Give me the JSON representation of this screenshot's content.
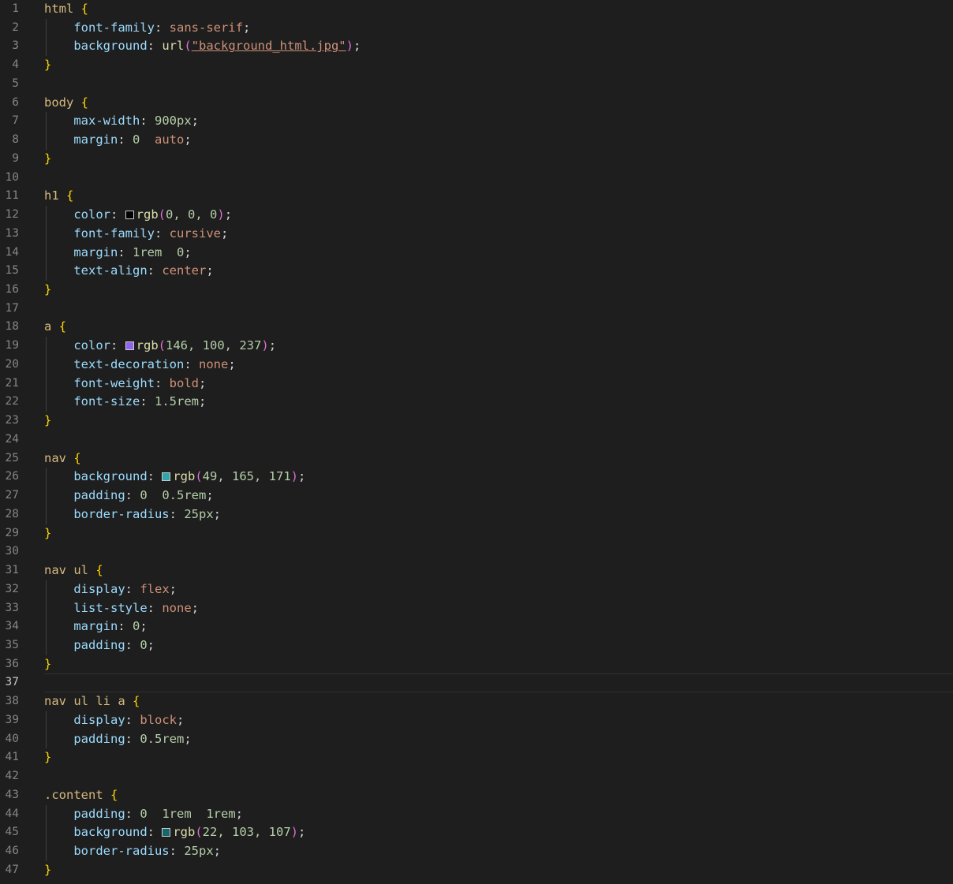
{
  "line_numbers": [
    "1",
    "2",
    "3",
    "4",
    "5",
    "6",
    "7",
    "8",
    "9",
    "10",
    "11",
    "12",
    "13",
    "14",
    "15",
    "16",
    "17",
    "18",
    "19",
    "20",
    "21",
    "22",
    "23",
    "24",
    "25",
    "26",
    "27",
    "28",
    "29",
    "30",
    "31",
    "32",
    "33",
    "34",
    "35",
    "36",
    "37",
    "38",
    "39",
    "40",
    "41",
    "42",
    "43",
    "44",
    "45",
    "46",
    "47"
  ],
  "active_line": "37",
  "code": {
    "l1": {
      "sel": "html",
      "brace": "{"
    },
    "l2": {
      "prop": "font-family",
      "val": "sans-serif"
    },
    "l3": {
      "prop": "background",
      "fn": "url",
      "str": "\"background_html.jpg\""
    },
    "l4": {
      "brace": "}"
    },
    "l6": {
      "sel": "body",
      "brace": "{"
    },
    "l7": {
      "prop": "max-width",
      "num": "900px"
    },
    "l8": {
      "prop": "margin",
      "num": "0",
      "val": "auto"
    },
    "l9": {
      "brace": "}"
    },
    "l11": {
      "sel": "h1",
      "brace": "{"
    },
    "l12": {
      "prop": "color",
      "fn": "rgb",
      "args": "0, 0, 0",
      "swatch": "#000000"
    },
    "l13": {
      "prop": "font-family",
      "val": "cursive"
    },
    "l14": {
      "prop": "margin",
      "num1": "1rem",
      "num2": "0"
    },
    "l15": {
      "prop": "text-align",
      "val": "center"
    },
    "l16": {
      "brace": "}"
    },
    "l18": {
      "sel": "a",
      "brace": "{"
    },
    "l19": {
      "prop": "color",
      "fn": "rgb",
      "args": "146, 100, 237",
      "swatch": "#9264ed"
    },
    "l20": {
      "prop": "text-decoration",
      "val": "none"
    },
    "l21": {
      "prop": "font-weight",
      "val": "bold"
    },
    "l22": {
      "prop": "font-size",
      "num": "1.5rem"
    },
    "l23": {
      "brace": "}"
    },
    "l25": {
      "sel": "nav",
      "brace": "{"
    },
    "l26": {
      "prop": "background",
      "fn": "rgb",
      "args": "49, 165, 171",
      "swatch": "#31a5ab"
    },
    "l27": {
      "prop": "padding",
      "num1": "0",
      "num2": "0.5rem"
    },
    "l28": {
      "prop": "border-radius",
      "num": "25px"
    },
    "l29": {
      "brace": "}"
    },
    "l31": {
      "sel": "nav ul",
      "brace": "{"
    },
    "l32": {
      "prop": "display",
      "val": "flex"
    },
    "l33": {
      "prop": "list-style",
      "val": "none"
    },
    "l34": {
      "prop": "margin",
      "num": "0"
    },
    "l35": {
      "prop": "padding",
      "num": "0"
    },
    "l36": {
      "brace": "}"
    },
    "l38": {
      "sel": "nav ul li a",
      "brace": "{"
    },
    "l39": {
      "prop": "display",
      "val": "block"
    },
    "l40": {
      "prop": "padding",
      "num": "0.5rem"
    },
    "l41": {
      "brace": "}"
    },
    "l43": {
      "sel": ".content",
      "brace": "{"
    },
    "l44": {
      "prop": "padding",
      "num1": "0",
      "num2": "1rem",
      "num3": "1rem"
    },
    "l45": {
      "prop": "background",
      "fn": "rgb",
      "args": "22, 103, 107",
      "swatch": "#16676b"
    },
    "l46": {
      "prop": "border-radius",
      "num": "25px"
    },
    "l47": {
      "brace": "}"
    }
  }
}
